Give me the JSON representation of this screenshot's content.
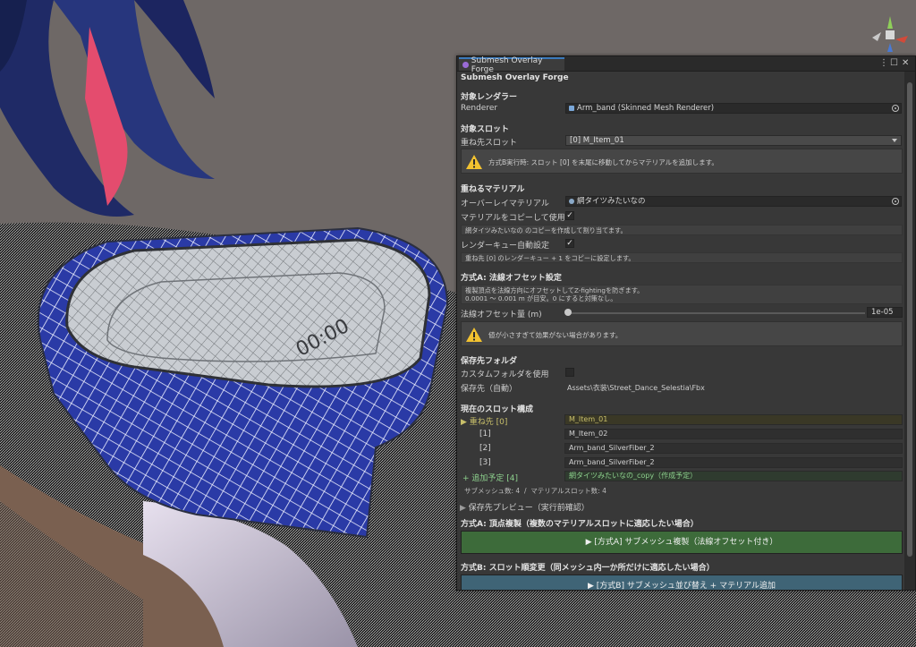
{
  "window": {
    "tab_title": "Submesh Overlay Forge",
    "menu_icon": "kebab-menu-icon",
    "maximize_icon": "maximize-icon",
    "close_icon": "close-icon"
  },
  "header": {
    "title": "Submesh Overlay Forge"
  },
  "renderer_section": {
    "heading": "対象レンダラー",
    "label": "Renderer",
    "value": "Arm_band (Skinned Mesh Renderer)"
  },
  "slot_section": {
    "heading": "対象スロット",
    "label": "重ね先スロット",
    "selected": "[0] M_Item_01",
    "warning": "方式B実行時: スロット [0] を末尾に移動してからマテリアルを追加します。"
  },
  "material_section": {
    "heading": "重ねるマテリアル",
    "overlay_label": "オーバーレイマテリアル",
    "overlay_value": "網タイツみたいなの",
    "copy_label": "マテリアルをコピーして使用",
    "copy_checked": true,
    "copy_info": "網タイツみたいなの のコピーを作成して割り当てます。",
    "queue_label": "レンダーキュー自動設定",
    "queue_checked": true,
    "queue_info": "重ね先 [0] のレンダーキュー + 1 をコピーに設定します。"
  },
  "offset_section": {
    "heading": "方式A: 法線オフセット設定",
    "info_line1": "複製頂点を法線方向にオフセットしてZ-fightingを防ぎます。",
    "info_line2": "0.0001 ～ 0.001 m が目安。0 にすると対策なし。",
    "slider_label": "法線オフセット量 (m)",
    "slider_value": "1e-05",
    "slider_fraction": 0,
    "warning": "値が小さすぎて効果がない場合があります。"
  },
  "save_section": {
    "heading": "保存先フォルダ",
    "custom_label": "カスタムフォルダを使用",
    "custom_checked": false,
    "path_label": "保存先（自動）",
    "path_value": "Assets\\衣装\\Street_Dance_Selestia\\Fbx"
  },
  "slots_section": {
    "heading": "現在のスロット構成",
    "rows": [
      {
        "label": "▶ 重ね先 [0]",
        "value": "M_Item_01"
      },
      {
        "label": "[1]",
        "value": "M_Item_02"
      },
      {
        "label": "[2]",
        "value": "Arm_band_SilverFiber_2"
      },
      {
        "label": "[3]",
        "value": "Arm_band_SilverFiber_2"
      },
      {
        "label": "+ 追加予定 [4]",
        "value": "網タイツみたいなの_copy（作成予定）"
      }
    ],
    "counts": "サブメッシュ数: 4  /  マテリアルスロット数: 4"
  },
  "preview": {
    "label": "保存先プレビュー（実行前確認）"
  },
  "method_a": {
    "heading": "方式A: 頂点複製（複数のマテリアルスロットに適応したい場合）",
    "button": "▶ [方式A] サブメッシュ複製（法線オフセット付き）"
  },
  "method_b": {
    "heading": "方式B: スロット順変更（同メッシュ内一か所だけに適応したい場合）",
    "button": "▶ [方式B] サブメッシュ並び替え + マテリアル追加"
  },
  "colors": {
    "accent": "#3a79bb",
    "highlight_text": "#c9c06a",
    "added_text": "#8ccf8c",
    "method_a_button": "#3d6b3a",
    "method_b_button": "#3f6476",
    "warning": "#f2c230"
  }
}
